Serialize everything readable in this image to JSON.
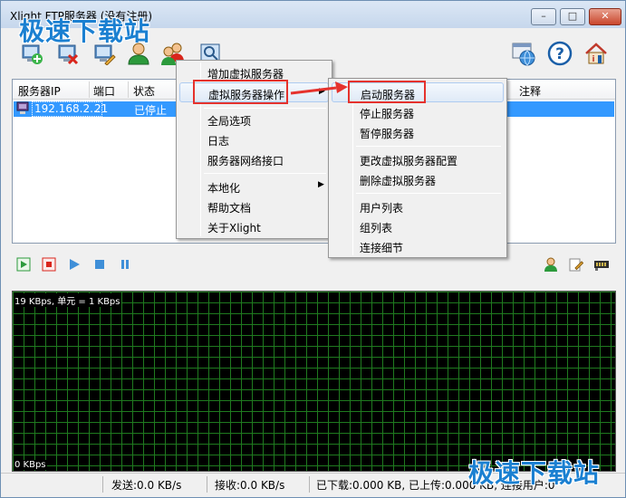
{
  "window": {
    "title": "Xlight FTP服务器 (没有注册)",
    "minimize_glyph": "–",
    "maximize_glyph": "□",
    "close_glyph": "✕"
  },
  "watermark": {
    "text": "极速下载站"
  },
  "toolbar": {
    "buttons": [
      {
        "name": "add-server-icon"
      },
      {
        "name": "delete-server-icon"
      },
      {
        "name": "edit-server-icon"
      },
      {
        "name": "user-icon"
      },
      {
        "name": "group-icon"
      },
      {
        "name": "connection-details-icon"
      }
    ],
    "right_buttons": [
      {
        "name": "internet-icon"
      },
      {
        "name": "help-icon"
      },
      {
        "name": "about-icon"
      }
    ]
  },
  "server_list": {
    "columns": [
      "服务器IP",
      "端口",
      "状态",
      "注释"
    ],
    "rows": [
      {
        "ip": "192.168.2...",
        "port": "21",
        "status": "已停止",
        "comment": ""
      }
    ]
  },
  "context_menu": {
    "items": [
      {
        "label": "增加虚拟服务器"
      },
      {
        "label": "虚拟服务器操作",
        "submenu": true
      },
      {
        "label": "全局选项"
      },
      {
        "label": "日志"
      },
      {
        "label": "服务器网络接口"
      },
      {
        "label": "本地化",
        "submenu": true
      },
      {
        "label": "帮助文档"
      },
      {
        "label": "关于Xlight"
      }
    ]
  },
  "submenu": {
    "items": [
      {
        "label": "启动服务器"
      },
      {
        "label": "停止服务器"
      },
      {
        "label": "暂停服务器"
      },
      {
        "label": "更改虚拟服务器配置"
      },
      {
        "label": "删除虚拟服务器"
      },
      {
        "label": "用户列表"
      },
      {
        "label": "组列表"
      },
      {
        "label": "连接细节"
      }
    ]
  },
  "graph": {
    "top_label": "19 KBps, 单元 = 1 KBps",
    "bottom_label": "0 KBps"
  },
  "status_bar": {
    "send": "发送:0.0 KB/s",
    "receive": "接收:0.0 KB/s",
    "transfer": "已下载:0.000 KB, 已上传:0.000 KB, 连接用户:0"
  },
  "colors": {
    "selection": "#3399ff",
    "annotation_red": "#e5322d",
    "watermark_blue": "#1b80d1",
    "graph_grid": "#1f7a1f"
  }
}
